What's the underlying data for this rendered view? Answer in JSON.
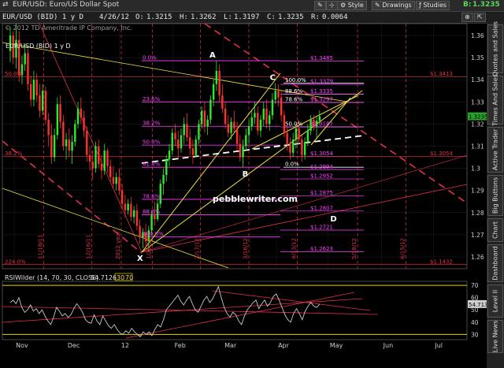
{
  "window": {
    "title": "EUR/USD: Euro/US Dollar Spot",
    "symbol": "EUR/USD",
    "style_label": "Style",
    "drawings_label": "Drawings",
    "studies_label": "Studies",
    "price_badge_letter": "B:",
    "price_badge_value": "1.3235"
  },
  "toolbar": {
    "quote": "EUR/USD (BID) 1 y D  4/26/12  O: 1.3215  H: 1.3262  L: 1.3197  C: 1.3235  R: 0.0064",
    "o_label": "O:",
    "o_value": "1.3215",
    "h_label": "H:",
    "h_value": "1.3262",
    "l_label": "L:",
    "l_value": "1.3197",
    "c_label": "C:",
    "c_value": "1.3235",
    "r_label": "R:",
    "r_value": "0.0064",
    "symbol_text": "EUR/USD (BID) 1 y D",
    "date_text": "4/26/12"
  },
  "sidebar": {
    "tabs": [
      "Quotes and Sales",
      "Times And Sales",
      "Active Trader",
      "Big Buttons",
      "Chart",
      "Dashboard",
      "Level II",
      "Live News"
    ]
  },
  "colors": {
    "background": "#000000",
    "up_candle": "#2eea2e",
    "down_candle": "#ff3030",
    "fib_magenta": "#ff40ff",
    "trend_yellow": "#f0e040",
    "channel_red": "#e0304a",
    "dashed_white": "#ffffff",
    "rsi_line": "#c8c8c8"
  },
  "chart_data": [
    {
      "type": "candlestick",
      "title": "EUR/USD (BID) 1 y D",
      "copyright": "© 2012 TD Ameritrade IP Company, Inc.",
      "watermark": "pebblewriter.com",
      "x_tick_labels": [
        "Nov",
        "Dec",
        "12",
        "Feb",
        "Mar",
        "Apr",
        "May",
        "Jun",
        "Jul"
      ],
      "y_tick_labels": [
        "1.36",
        "1.35",
        "1.34",
        "1.33",
        "1.32",
        "1.31",
        "1.3",
        "1.29",
        "1.28",
        "1.27",
        "1.26"
      ],
      "ylim": [
        1.255,
        1.365
      ],
      "last_price": 1.3235,
      "last_price_label": "1.3235",
      "wave_labels": [
        {
          "text": "A",
          "date": "2012-02-24",
          "price": 1.3486
        },
        {
          "text": "B",
          "date": "2012-03-14",
          "price": 1.3005
        },
        {
          "text": "C",
          "date": "2012-03-30",
          "price": 1.3385
        },
        {
          "text": "D",
          "date": "2012-05-04",
          "price": 1.2745
        },
        {
          "text": "X",
          "date": "2012-01-13",
          "price": 1.2624
        }
      ],
      "fib_retracement_left": [
        {
          "label": "0.0%",
          "price": 1.3486
        },
        {
          "label": "23.6%",
          "price": 1.33
        },
        {
          "label": "38.2%",
          "price": 1.319
        },
        {
          "label": "50.0%",
          "price": 1.3105
        },
        {
          "label": "61.8%",
          "price": 1.3005
        },
        {
          "label": "78.6%",
          "price": 1.286
        },
        {
          "label": "88.6%",
          "price": 1.279
        },
        {
          "label": "100.0%",
          "price": 1.269
        }
      ],
      "fib_retracement_right": [
        {
          "label": "100.0%",
          "price": 1.3385
        },
        {
          "label": "88.6%",
          "price": 1.3335
        },
        {
          "label": "78.6%",
          "price": 1.3297
        },
        {
          "label": "50.0%",
          "price": 1.3187
        },
        {
          "label": "0.0%",
          "price": 1.3005
        }
      ],
      "price_levels": [
        {
          "label": "$1.3485",
          "price": 1.3485
        },
        {
          "label": "$1.3379",
          "price": 1.3379
        },
        {
          "label": "$1.3335",
          "price": 1.3335
        },
        {
          "label": "$1.3297",
          "price": 1.3297
        },
        {
          "label": "$1.3187",
          "price": 1.3187
        },
        {
          "label": "$1.3054",
          "price": 1.3054
        },
        {
          "label": "$1.2994",
          "price": 1.2994
        },
        {
          "label": "$1.2952",
          "price": 1.2952
        },
        {
          "label": "$1.2875",
          "price": 1.2875
        },
        {
          "label": "$1.2807",
          "price": 1.2807
        },
        {
          "label": "$1.2721",
          "price": 1.2721
        },
        {
          "label": "$1.2623",
          "price": 1.2623
        }
      ],
      "left_levels": [
        {
          "label": "50.0%",
          "price": 1.3413
        },
        {
          "label": "38.2%",
          "price": 1.3054
        },
        {
          "label": "224.0%",
          "price": 1.2565
        }
      ],
      "right_levels": [
        {
          "label": "$1.3413",
          "price": 1.3413
        },
        {
          "label": "$1.3054",
          "price": 1.3054
        },
        {
          "label": "$1.1432",
          "price": 1.2565
        }
      ],
      "vertical_date_labels": [
        "11/18/11",
        "12/16/11",
        "2012 year",
        "1/20/12",
        "2/17/12",
        "3/16/12",
        "4/13/12",
        "5/18/12",
        "6/15/12"
      ],
      "candles": [
        {
          "o": 1.353,
          "h": 1.364,
          "l": 1.348,
          "c": 1.36
        },
        {
          "o": 1.36,
          "h": 1.362,
          "l": 1.347,
          "c": 1.35
        },
        {
          "o": 1.35,
          "h": 1.366,
          "l": 1.345,
          "c": 1.358
        },
        {
          "o": 1.358,
          "h": 1.362,
          "l": 1.339,
          "c": 1.342
        },
        {
          "o": 1.342,
          "h": 1.351,
          "l": 1.338,
          "c": 1.347
        },
        {
          "o": 1.347,
          "h": 1.356,
          "l": 1.344,
          "c": 1.352
        },
        {
          "o": 1.352,
          "h": 1.354,
          "l": 1.335,
          "c": 1.338
        },
        {
          "o": 1.338,
          "h": 1.342,
          "l": 1.328,
          "c": 1.331
        },
        {
          "o": 1.331,
          "h": 1.344,
          "l": 1.328,
          "c": 1.34
        },
        {
          "o": 1.34,
          "h": 1.343,
          "l": 1.33,
          "c": 1.333
        },
        {
          "o": 1.333,
          "h": 1.338,
          "l": 1.323,
          "c": 1.326
        },
        {
          "o": 1.326,
          "h": 1.338,
          "l": 1.324,
          "c": 1.335
        },
        {
          "o": 1.335,
          "h": 1.337,
          "l": 1.32,
          "c": 1.322
        },
        {
          "o": 1.322,
          "h": 1.325,
          "l": 1.31,
          "c": 1.315
        },
        {
          "o": 1.315,
          "h": 1.32,
          "l": 1.302,
          "c": 1.305
        },
        {
          "o": 1.305,
          "h": 1.318,
          "l": 1.303,
          "c": 1.315
        },
        {
          "o": 1.315,
          "h": 1.332,
          "l": 1.313,
          "c": 1.329
        },
        {
          "o": 1.329,
          "h": 1.333,
          "l": 1.318,
          "c": 1.321
        },
        {
          "o": 1.321,
          "h": 1.324,
          "l": 1.308,
          "c": 1.31
        },
        {
          "o": 1.31,
          "h": 1.316,
          "l": 1.304,
          "c": 1.313
        },
        {
          "o": 1.313,
          "h": 1.318,
          "l": 1.305,
          "c": 1.308
        },
        {
          "o": 1.308,
          "h": 1.315,
          "l": 1.302,
          "c": 1.312
        },
        {
          "o": 1.312,
          "h": 1.322,
          "l": 1.31,
          "c": 1.32
        },
        {
          "o": 1.32,
          "h": 1.33,
          "l": 1.318,
          "c": 1.327
        },
        {
          "o": 1.327,
          "h": 1.332,
          "l": 1.32,
          "c": 1.323
        },
        {
          "o": 1.323,
          "h": 1.326,
          "l": 1.314,
          "c": 1.317
        },
        {
          "o": 1.317,
          "h": 1.319,
          "l": 1.303,
          "c": 1.306
        },
        {
          "o": 1.306,
          "h": 1.31,
          "l": 1.299,
          "c": 1.303
        },
        {
          "o": 1.303,
          "h": 1.308,
          "l": 1.295,
          "c": 1.3
        },
        {
          "o": 1.3,
          "h": 1.312,
          "l": 1.298,
          "c": 1.31
        },
        {
          "o": 1.31,
          "h": 1.313,
          "l": 1.3,
          "c": 1.302
        },
        {
          "o": 1.302,
          "h": 1.306,
          "l": 1.295,
          "c": 1.299
        },
        {
          "o": 1.299,
          "h": 1.311,
          "l": 1.297,
          "c": 1.308
        },
        {
          "o": 1.308,
          "h": 1.309,
          "l": 1.298,
          "c": 1.301
        },
        {
          "o": 1.301,
          "h": 1.304,
          "l": 1.294,
          "c": 1.296
        },
        {
          "o": 1.296,
          "h": 1.301,
          "l": 1.291,
          "c": 1.293
        },
        {
          "o": 1.293,
          "h": 1.298,
          "l": 1.29,
          "c": 1.296
        },
        {
          "o": 1.296,
          "h": 1.3,
          "l": 1.288,
          "c": 1.29
        },
        {
          "o": 1.29,
          "h": 1.293,
          "l": 1.282,
          "c": 1.284
        },
        {
          "o": 1.284,
          "h": 1.288,
          "l": 1.278,
          "c": 1.281
        },
        {
          "o": 1.281,
          "h": 1.286,
          "l": 1.279,
          "c": 1.284
        },
        {
          "o": 1.284,
          "h": 1.287,
          "l": 1.276,
          "c": 1.278
        },
        {
          "o": 1.278,
          "h": 1.283,
          "l": 1.275,
          "c": 1.281
        },
        {
          "o": 1.281,
          "h": 1.284,
          "l": 1.272,
          "c": 1.274
        },
        {
          "o": 1.274,
          "h": 1.277,
          "l": 1.266,
          "c": 1.269
        },
        {
          "o": 1.269,
          "h": 1.273,
          "l": 1.264,
          "c": 1.271
        },
        {
          "o": 1.271,
          "h": 1.275,
          "l": 1.263,
          "c": 1.267
        },
        {
          "o": 1.267,
          "h": 1.274,
          "l": 1.2624,
          "c": 1.272
        },
        {
          "o": 1.272,
          "h": 1.281,
          "l": 1.27,
          "c": 1.279
        },
        {
          "o": 1.279,
          "h": 1.285,
          "l": 1.274,
          "c": 1.277
        },
        {
          "o": 1.277,
          "h": 1.286,
          "l": 1.276,
          "c": 1.284
        },
        {
          "o": 1.284,
          "h": 1.295,
          "l": 1.282,
          "c": 1.293
        },
        {
          "o": 1.293,
          "h": 1.3,
          "l": 1.288,
          "c": 1.297
        },
        {
          "o": 1.297,
          "h": 1.306,
          "l": 1.294,
          "c": 1.304
        },
        {
          "o": 1.304,
          "h": 1.311,
          "l": 1.301,
          "c": 1.308
        },
        {
          "o": 1.308,
          "h": 1.318,
          "l": 1.306,
          "c": 1.316
        },
        {
          "o": 1.316,
          "h": 1.32,
          "l": 1.31,
          "c": 1.313
        },
        {
          "o": 1.313,
          "h": 1.317,
          "l": 1.305,
          "c": 1.309
        },
        {
          "o": 1.309,
          "h": 1.318,
          "l": 1.307,
          "c": 1.315
        },
        {
          "o": 1.315,
          "h": 1.323,
          "l": 1.311,
          "c": 1.32
        },
        {
          "o": 1.32,
          "h": 1.325,
          "l": 1.312,
          "c": 1.314
        },
        {
          "o": 1.314,
          "h": 1.318,
          "l": 1.306,
          "c": 1.309
        },
        {
          "o": 1.309,
          "h": 1.313,
          "l": 1.302,
          "c": 1.306
        },
        {
          "o": 1.306,
          "h": 1.315,
          "l": 1.305,
          "c": 1.313
        },
        {
          "o": 1.313,
          "h": 1.322,
          "l": 1.311,
          "c": 1.32
        },
        {
          "o": 1.32,
          "h": 1.328,
          "l": 1.318,
          "c": 1.326
        },
        {
          "o": 1.326,
          "h": 1.33,
          "l": 1.316,
          "c": 1.319
        },
        {
          "o": 1.319,
          "h": 1.324,
          "l": 1.315,
          "c": 1.322
        },
        {
          "o": 1.322,
          "h": 1.333,
          "l": 1.32,
          "c": 1.331
        },
        {
          "o": 1.331,
          "h": 1.34,
          "l": 1.328,
          "c": 1.338
        },
        {
          "o": 1.338,
          "h": 1.3486,
          "l": 1.335,
          "c": 1.344
        },
        {
          "o": 1.344,
          "h": 1.347,
          "l": 1.33,
          "c": 1.333
        },
        {
          "o": 1.333,
          "h": 1.338,
          "l": 1.325,
          "c": 1.327
        },
        {
          "o": 1.327,
          "h": 1.33,
          "l": 1.318,
          "c": 1.32
        },
        {
          "o": 1.32,
          "h": 1.324,
          "l": 1.314,
          "c": 1.316
        },
        {
          "o": 1.316,
          "h": 1.323,
          "l": 1.313,
          "c": 1.321
        },
        {
          "o": 1.321,
          "h": 1.326,
          "l": 1.316,
          "c": 1.318
        },
        {
          "o": 1.318,
          "h": 1.321,
          "l": 1.308,
          "c": 1.311
        },
        {
          "o": 1.311,
          "h": 1.315,
          "l": 1.303,
          "c": 1.305
        },
        {
          "o": 1.305,
          "h": 1.313,
          "l": 1.3005,
          "c": 1.31
        },
        {
          "o": 1.31,
          "h": 1.318,
          "l": 1.308,
          "c": 1.315
        },
        {
          "o": 1.315,
          "h": 1.322,
          "l": 1.311,
          "c": 1.319
        },
        {
          "o": 1.319,
          "h": 1.326,
          "l": 1.317,
          "c": 1.323
        },
        {
          "o": 1.323,
          "h": 1.33,
          "l": 1.32,
          "c": 1.325
        },
        {
          "o": 1.325,
          "h": 1.328,
          "l": 1.315,
          "c": 1.317
        },
        {
          "o": 1.317,
          "h": 1.324,
          "l": 1.314,
          "c": 1.322
        },
        {
          "o": 1.322,
          "h": 1.33,
          "l": 1.319,
          "c": 1.327
        },
        {
          "o": 1.327,
          "h": 1.331,
          "l": 1.318,
          "c": 1.32
        },
        {
          "o": 1.32,
          "h": 1.326,
          "l": 1.317,
          "c": 1.324
        },
        {
          "o": 1.324,
          "h": 1.334,
          "l": 1.322,
          "c": 1.331
        },
        {
          "o": 1.331,
          "h": 1.3385,
          "l": 1.329,
          "c": 1.335
        },
        {
          "o": 1.335,
          "h": 1.338,
          "l": 1.328,
          "c": 1.332
        },
        {
          "o": 1.332,
          "h": 1.335,
          "l": 1.321,
          "c": 1.324
        },
        {
          "o": 1.324,
          "h": 1.326,
          "l": 1.314,
          "c": 1.316
        },
        {
          "o": 1.316,
          "h": 1.319,
          "l": 1.308,
          "c": 1.311
        },
        {
          "o": 1.311,
          "h": 1.314,
          "l": 1.304,
          "c": 1.307
        },
        {
          "o": 1.307,
          "h": 1.316,
          "l": 1.305,
          "c": 1.313
        },
        {
          "o": 1.313,
          "h": 1.32,
          "l": 1.309,
          "c": 1.318
        },
        {
          "o": 1.318,
          "h": 1.322,
          "l": 1.311,
          "c": 1.313
        },
        {
          "o": 1.313,
          "h": 1.315,
          "l": 1.303,
          "c": 1.306
        },
        {
          "o": 1.306,
          "h": 1.314,
          "l": 1.304,
          "c": 1.312
        },
        {
          "o": 1.312,
          "h": 1.32,
          "l": 1.31,
          "c": 1.317
        },
        {
          "o": 1.317,
          "h": 1.324,
          "l": 1.315,
          "c": 1.322
        },
        {
          "o": 1.322,
          "h": 1.324,
          "l": 1.317,
          "c": 1.319
        },
        {
          "o": 1.319,
          "h": 1.323,
          "l": 1.314,
          "c": 1.3215
        },
        {
          "o": 1.3215,
          "h": 1.3262,
          "l": 1.3197,
          "c": 1.3235
        }
      ]
    },
    {
      "type": "line",
      "title": "RSIWilder (14, 70, 30, CLOSE)",
      "last_value": 54.7126,
      "last_value_label": "54.7126",
      "last_value_tag": "54.713",
      "overbought": 70,
      "oversold": 30,
      "marker_30": "30",
      "marker_70": "70",
      "ylim": [
        27,
        72
      ],
      "y_tick_labels": [
        "70",
        "60",
        "50",
        "40",
        "30"
      ],
      "values": [
        56,
        58,
        55,
        60,
        52,
        48,
        50,
        54,
        49,
        51,
        47,
        50,
        45,
        41,
        38,
        44,
        52,
        49,
        45,
        47,
        44,
        46,
        51,
        55,
        52,
        48,
        42,
        40,
        39,
        46,
        41,
        38,
        45,
        41,
        37,
        35,
        38,
        34,
        31,
        30,
        33,
        31,
        35,
        32,
        30,
        28,
        32,
        30,
        32,
        29,
        34,
        38,
        36,
        42,
        50,
        53,
        56,
        59,
        62,
        57,
        54,
        58,
        61,
        55,
        50,
        48,
        53,
        58,
        61,
        56,
        59,
        64,
        69,
        60,
        52,
        47,
        44,
        48,
        46,
        41,
        38,
        45,
        50,
        53,
        56,
        58,
        51,
        55,
        58,
        53,
        56,
        61,
        63,
        58,
        52,
        46,
        42,
        40,
        47,
        51,
        47,
        42,
        49,
        53,
        56,
        53,
        52,
        54.7126
      ]
    }
  ]
}
